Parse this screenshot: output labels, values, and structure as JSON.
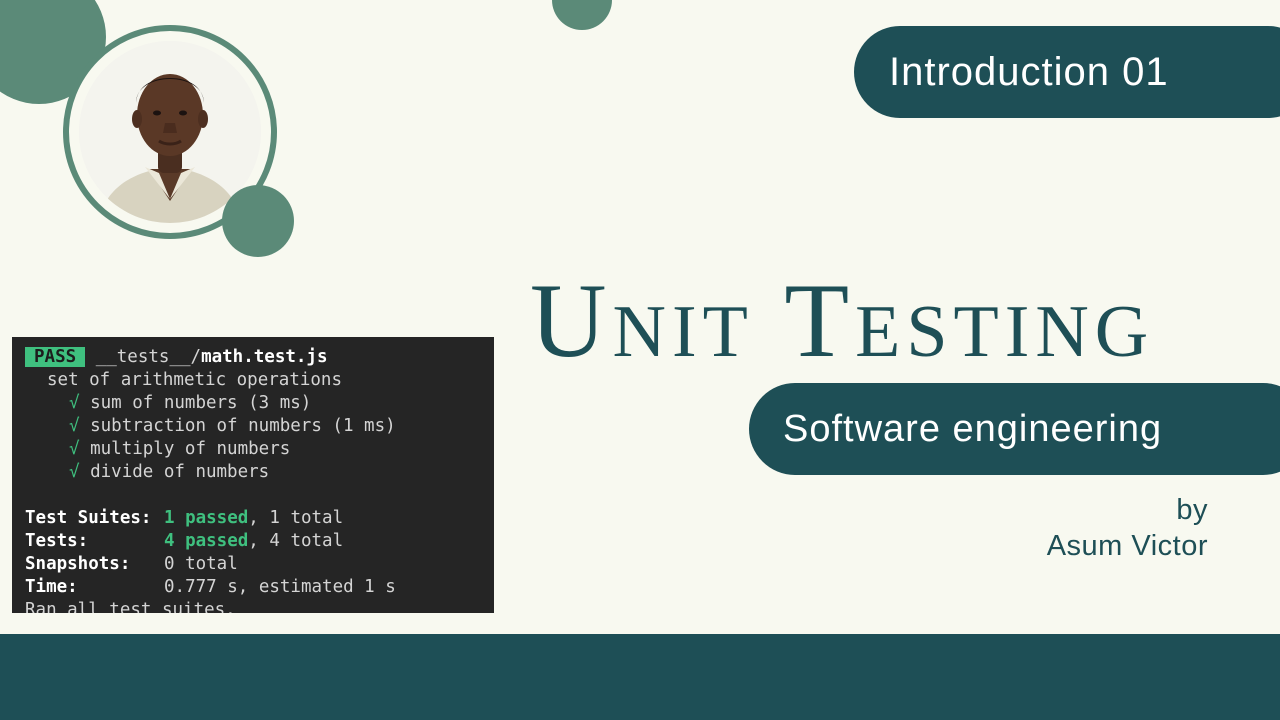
{
  "intro_label": "Introduction 01",
  "title": "Unit Testing",
  "subtitle": "Software engineering",
  "by_label": "by",
  "author": "Asum Victor",
  "terminal": {
    "pass_badge": "PASS",
    "file_prefix": "__tests__/",
    "file_name": "math.test.js",
    "suite_name": "set of arithmetic operations",
    "check_glyph": "√",
    "tests": [
      "sum of numbers (3 ms)",
      "subtraction of numbers (1 ms)",
      "multiply of numbers",
      "divide of numbers"
    ],
    "summary": {
      "suites_label": "Test Suites:",
      "suites_passed": "1 passed",
      "suites_total": ", 1 total",
      "tests_label": "Tests:",
      "tests_passed": "4 passed",
      "tests_total": ", 4 total",
      "snapshots_label": "Snapshots:",
      "snapshots_value": "0 total",
      "time_label": "Time:",
      "time_value": "0.777 s, estimated 1 s",
      "ran_all": "Ran all test suites."
    }
  },
  "colors": {
    "background": "#f8f9f0",
    "primary": "#1e4f56",
    "accent": "#5b8a78",
    "terminal_bg": "#252525",
    "pass_green": "#3fc07f"
  }
}
